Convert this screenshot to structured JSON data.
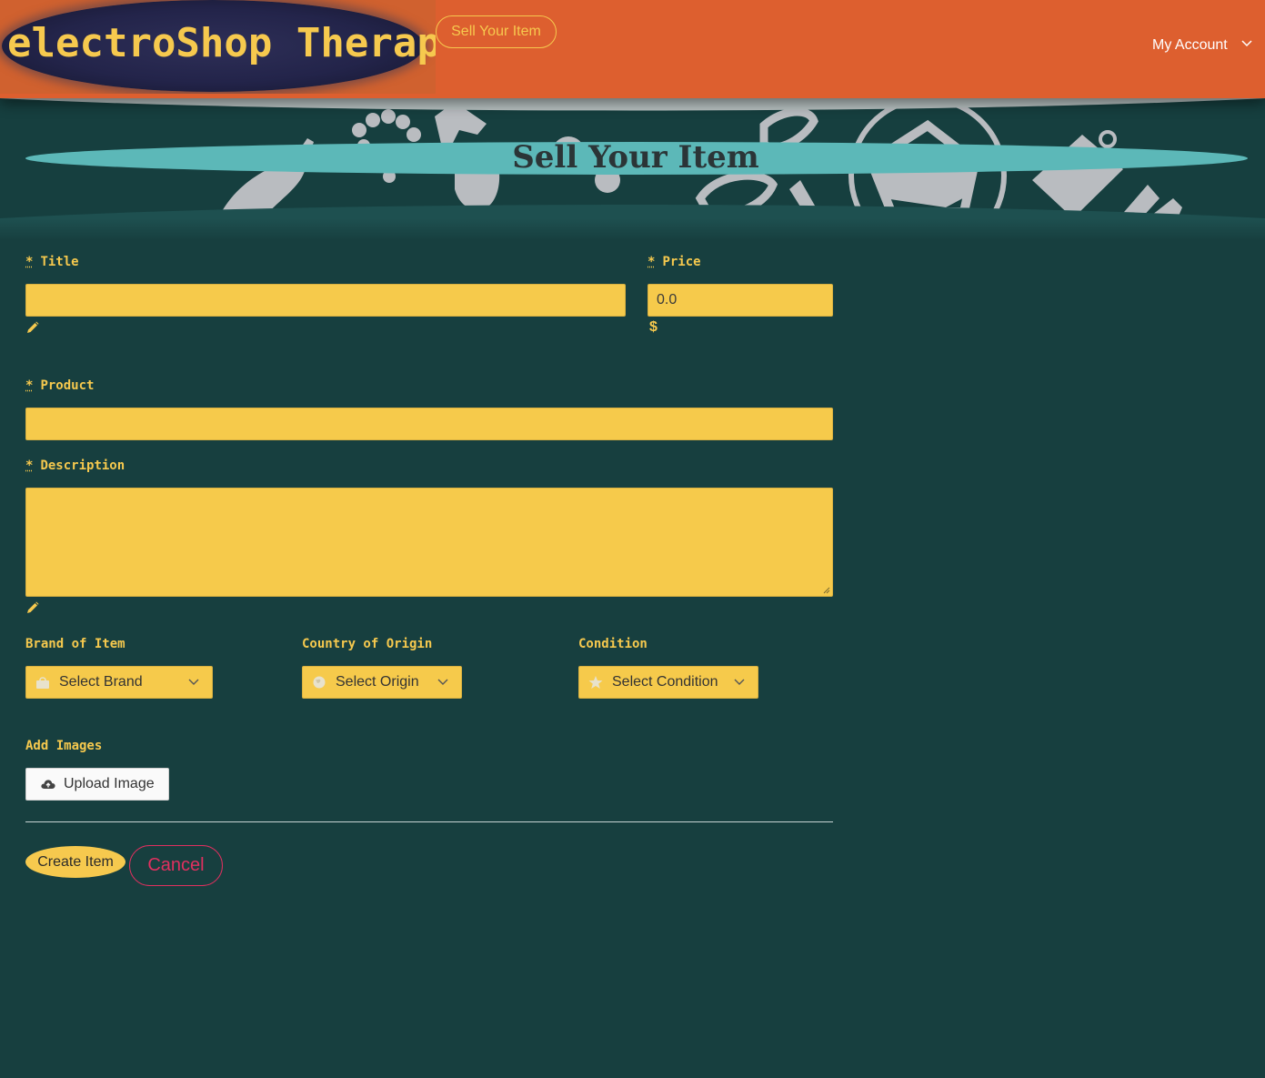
{
  "header": {
    "logo_text": "electroShop Therapy",
    "nav_sell_label": "Sell Your Item",
    "account_label": "My Account"
  },
  "hero": {
    "title": "Sell Your Item"
  },
  "form": {
    "title_label": "Title",
    "price_label": "Price",
    "price_value": "0.0",
    "price_hint_symbol": "$",
    "product_label": "Product",
    "description_label": "Description",
    "required_marker": "*",
    "brand_label": "Brand of Item",
    "brand_placeholder": "Select Brand",
    "origin_label": "Country of Origin",
    "origin_placeholder": "Select Origin",
    "condition_label": "Condition",
    "condition_placeholder": "Select Condition",
    "images_label": "Add Images",
    "upload_label": "Upload Image",
    "create_label": "Create Item",
    "cancel_label": "Cancel"
  },
  "colors": {
    "header_bg": "#dd5f2f",
    "page_bg": "#173f3f",
    "accent_yellow": "#f6c94e",
    "hero_band": "#5cb8b8",
    "cancel_red": "#e0305f"
  },
  "icons": {
    "title_hint": "pencil-icon",
    "description_hint": "pencil-icon",
    "price_hint": "dollar-icon",
    "brand": "shopping-bag-icon",
    "origin": "globe-icon",
    "condition": "star-icon",
    "upload": "cloud-upload-icon",
    "account_menu": "chevron-down-icon"
  }
}
